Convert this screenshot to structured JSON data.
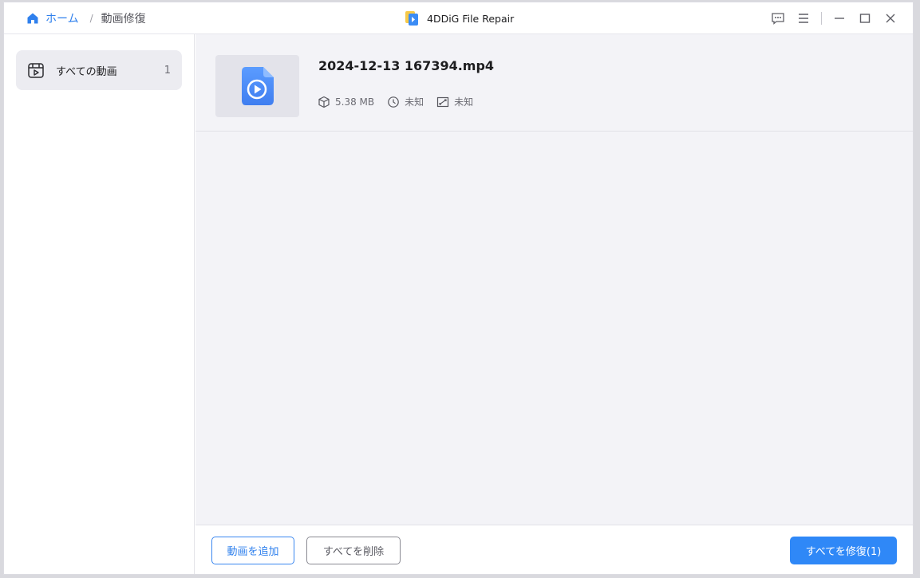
{
  "header": {
    "breadcrumb_home": "ホーム",
    "breadcrumb_separator": "/",
    "breadcrumb_current": "動画修復",
    "app_title": "4DDiG File Repair"
  },
  "sidebar": {
    "items": [
      {
        "label": "すべての動画",
        "count": "1"
      }
    ]
  },
  "files": [
    {
      "name": "2024-12-13 167394.mp4",
      "size": "5.38 MB",
      "duration": "未知",
      "resolution": "未知"
    }
  ],
  "footer": {
    "add_label": "動画を追加",
    "delete_label": "すべてを削除",
    "repair_label": "すべてを修復(1)"
  },
  "colors": {
    "accent": "#2f80ed",
    "primary_button": "#2f88f7",
    "sidebar_selected": "#ececf1",
    "main_bg": "#f3f3f7"
  },
  "icons": {
    "home": "home-icon",
    "logo": "app-logo-icon",
    "feedback": "feedback-icon",
    "menu": "menu-icon",
    "minimize": "minimize-icon",
    "maximize": "maximize-icon",
    "close": "close-icon",
    "video_folder": "video-folder-icon",
    "video_file": "video-file-icon",
    "size": "cube-icon",
    "duration": "clock-icon",
    "resolution": "resolution-icon"
  }
}
